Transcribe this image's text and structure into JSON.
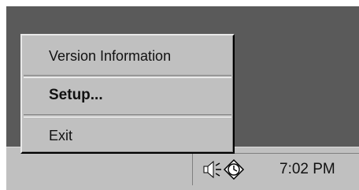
{
  "menu": {
    "items": [
      {
        "label": "Version Information",
        "bold": false
      },
      {
        "label": "Setup...",
        "bold": true
      },
      {
        "label": "Exit",
        "bold": false
      }
    ]
  },
  "tray": {
    "icons": [
      "speaker-volume-icon",
      "task-scheduler-icon"
    ],
    "clock": "7:02 PM"
  },
  "colors": {
    "desktop": "#5a5a5a",
    "face": "#c0c0c0"
  }
}
